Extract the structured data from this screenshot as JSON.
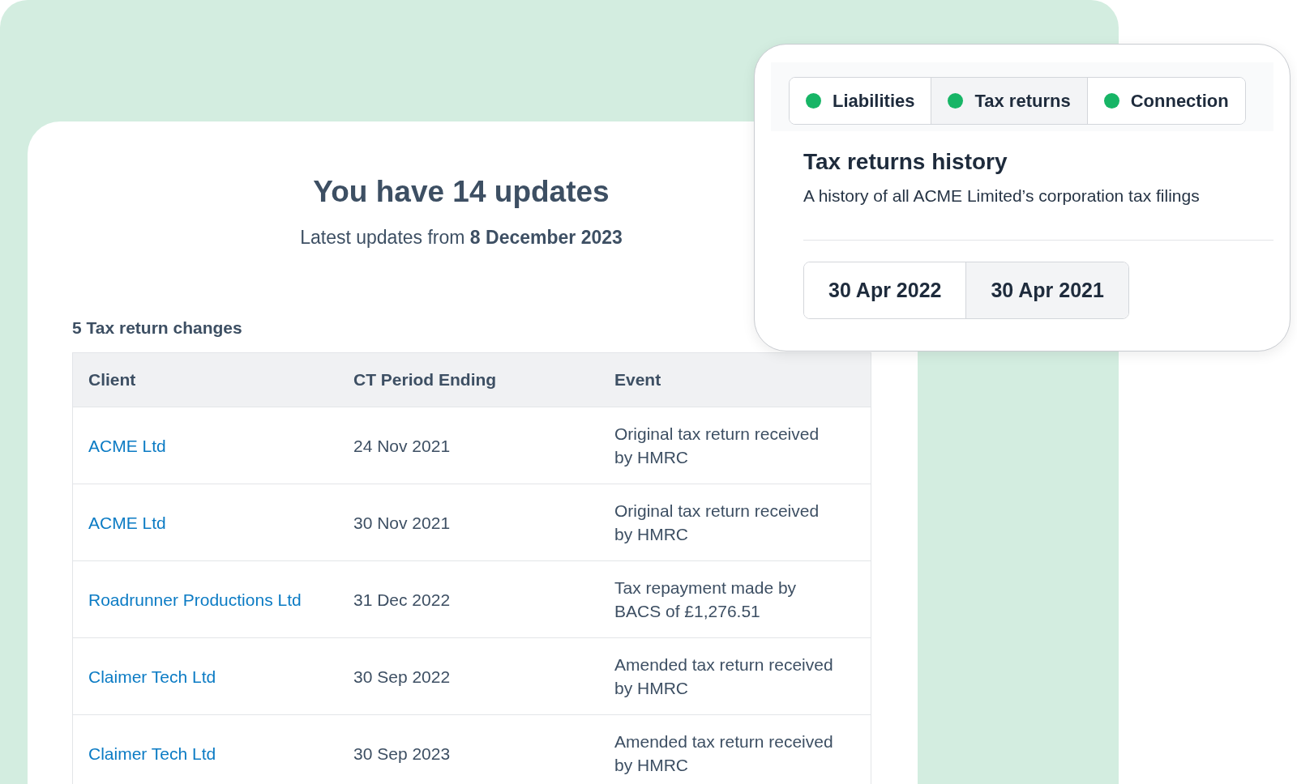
{
  "updates_card": {
    "title": "You have 14 updates",
    "subtitle": "Latest updates from **8 December 2023**",
    "section_title": "5 Tax return changes",
    "table": {
      "columns": [
        "Client",
        "CT Period Ending",
        "Event"
      ],
      "rows": [
        {
          "client": "ACME Ltd",
          "period": "24 Nov 2021",
          "event": "Original tax return received by HMRC"
        },
        {
          "client": "ACME Ltd",
          "period": "30 Nov 2021",
          "event": "Original tax return received by HMRC"
        },
        {
          "client": "Roadrunner Productions Ltd",
          "period": "31 Dec 2022",
          "event": "Tax repayment made by BACS of £1,276.51"
        },
        {
          "client": "Claimer Tech Ltd",
          "period": "30 Sep 2022",
          "event": "Amended tax return received by HMRC"
        },
        {
          "client": "Claimer Tech Ltd",
          "period": "30 Sep 2023",
          "event": "Amended tax return received by HMRC"
        }
      ]
    }
  },
  "history_panel": {
    "tabs": [
      {
        "label": "Liabilities",
        "selected": false
      },
      {
        "label": "Tax returns",
        "selected": true
      },
      {
        "label": "Connection",
        "selected": false
      }
    ],
    "title": "Tax returns history",
    "description": "A history of all ACME Limited’s corporation tax filings",
    "period_tabs": [
      {
        "label": "30 Apr 2022",
        "selected": false
      },
      {
        "label": "30 Apr 2021",
        "selected": true
      }
    ]
  }
}
